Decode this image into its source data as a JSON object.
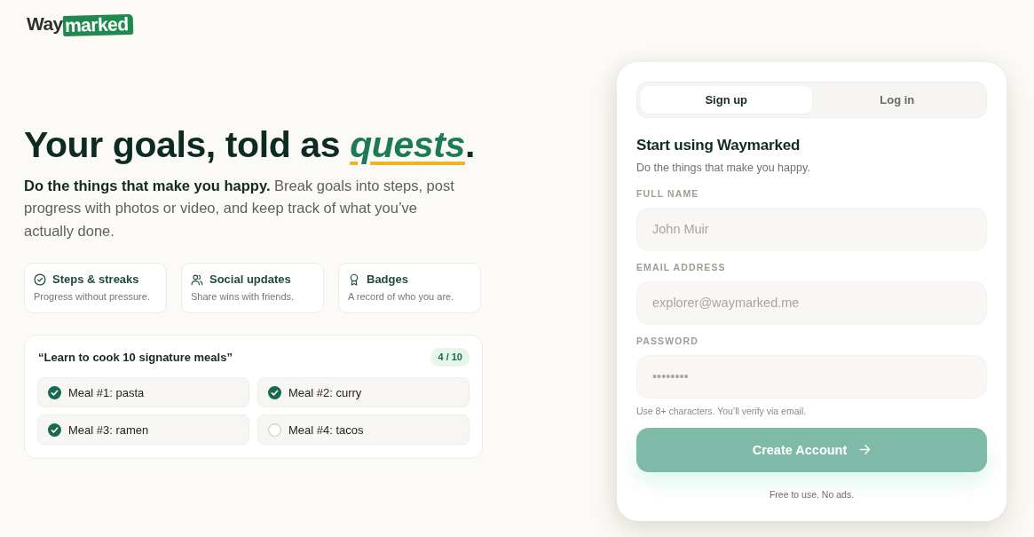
{
  "logo": {
    "lead": "Way",
    "highlight": "marked"
  },
  "hero": {
    "headline": "Your goals, told as *quests*.",
    "intro": "**Do the things that make you happy.** Break goals into steps, post progress with photos or video, and keep track of what you’ve actually done."
  },
  "features": [
    {
      "title": "Steps & streaks",
      "description": "Progress without pressure."
    },
    {
      "title": "Social updates",
      "description": "Share wins with friends."
    },
    {
      "title": "Badges",
      "description": "A record of who you are."
    }
  ],
  "goal": {
    "title": "“Learn to cook 10 signature meals”",
    "progress": "4 / 10",
    "steps": [
      {
        "label": "Meal #1: pasta",
        "checked": true
      },
      {
        "label": "Meal #2: curry",
        "checked": true
      },
      {
        "label": "Meal #3: ramen",
        "checked": true
      },
      {
        "label": "Meal #4: tacos",
        "checked": false
      }
    ]
  },
  "auth": {
    "tabs": [
      {
        "label": "Sign up",
        "selected": true
      },
      {
        "label": "Log in",
        "selected": false
      }
    ],
    "heading": "Start using Waymarked",
    "subheading": "Do the things that make you happy.",
    "fields": [
      {
        "label": "FULL NAME",
        "placeholder": "John Muir"
      },
      {
        "label": "EMAIL ADDRESS",
        "placeholder": "explorer@waymarked.me"
      },
      {
        "label": "PASSWORD",
        "placeholder": "••••••••"
      }
    ],
    "hint": "Use 8+ characters. You’ll verify via email.",
    "submit": {
      "label": "Create Account",
      "disabled": true
    },
    "note": "Free to use. No ads."
  }
}
